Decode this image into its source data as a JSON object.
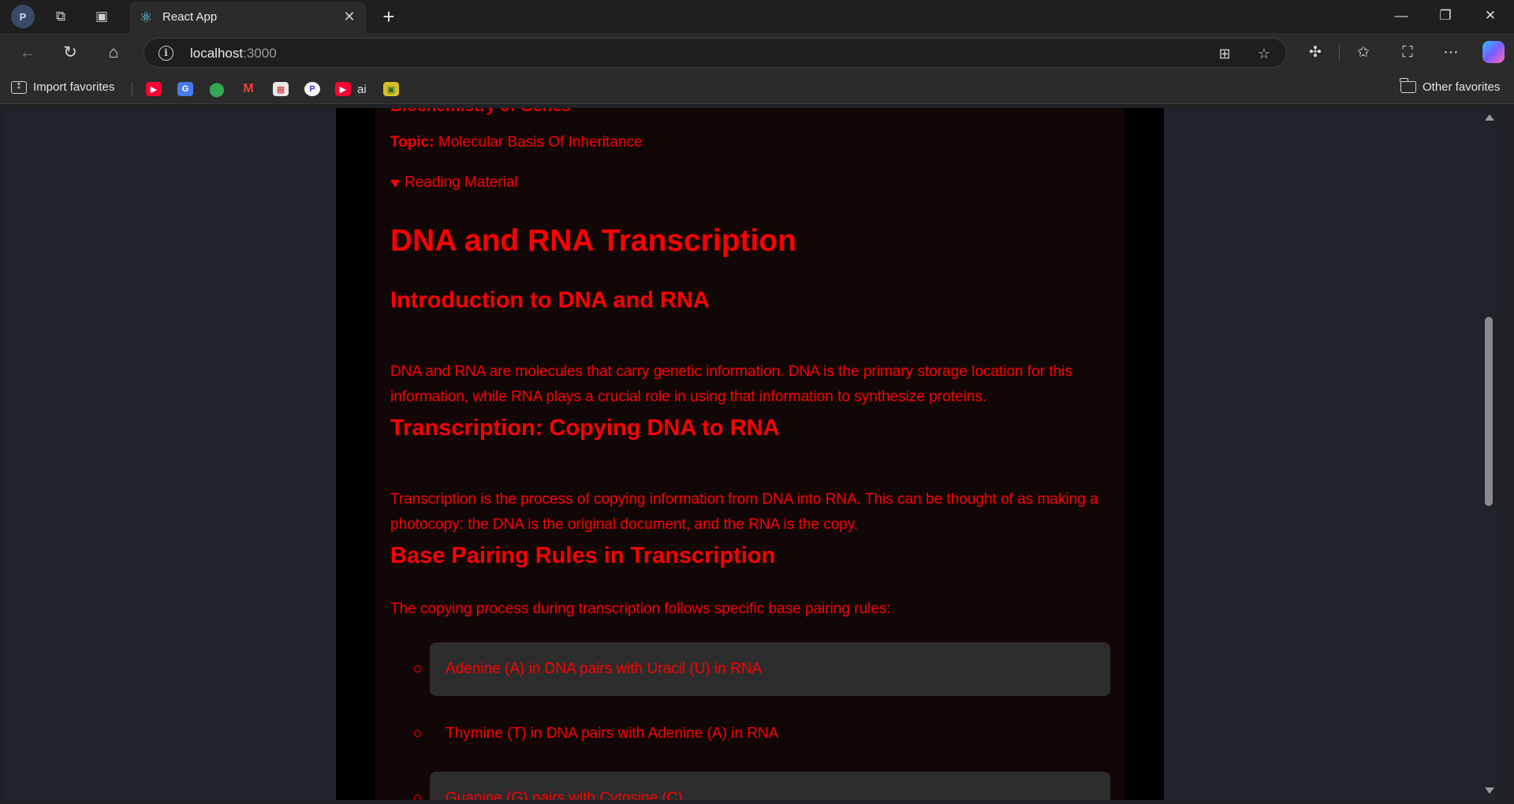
{
  "browser": {
    "tab_title": "React App",
    "url_host": "localhost",
    "url_port": ":3000",
    "favorites": {
      "import_label": "Import favorites",
      "ai_label": "ai",
      "other_label": "Other favorites"
    }
  },
  "content": {
    "cut_title": "Biochemistry of Genes",
    "topic_label": "Topic:",
    "topic_value": "Molecular Basis Of Inheritance",
    "reading_toggle": "Reading Material",
    "h1": "DNA and RNA Transcription",
    "sections": [
      {
        "heading": "Introduction to DNA and RNA",
        "text": "DNA and RNA are molecules that carry genetic information. DNA is the primary storage location for this information, while RNA plays a crucial role in using that information to synthesize proteins."
      },
      {
        "heading": "Transcription: Copying DNA to RNA",
        "text": "Transcription is the process of copying information from DNA into RNA. This can be thought of as making a photocopy: the DNA is the original document, and the RNA is the copy."
      },
      {
        "heading": "Base Pairing Rules in Transcription",
        "text": "The copying process during transcription follows specific base pairing rules:"
      }
    ],
    "rules": [
      "Adenine (A) in DNA pairs with Uracil (U) in RNA",
      "Thymine (T) in DNA pairs with Adenine (A) in RNA",
      "Guanine (G) pairs with Cytosine (C)"
    ]
  },
  "colors": {
    "accent_text": "#ff0000",
    "card_bg": "#120707",
    "shaded_item_bg": "#2d2d2d"
  }
}
